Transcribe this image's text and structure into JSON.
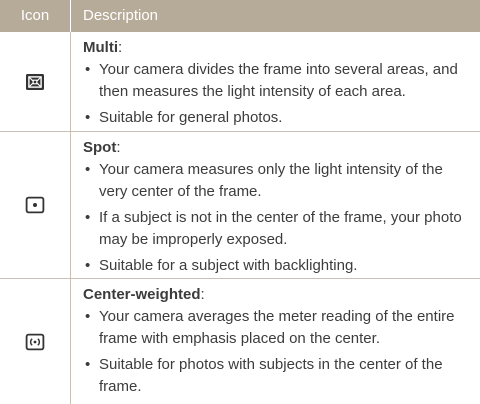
{
  "header": {
    "icon_col": "Icon",
    "desc_col": "Description"
  },
  "rows": [
    {
      "icon": "multi-metering-icon",
      "title": "Multi",
      "bullets": [
        "Your camera divides the frame into several areas, and then measures the light intensity of each area.",
        "Suitable for general photos."
      ]
    },
    {
      "icon": "spot-metering-icon",
      "title": "Spot",
      "bullets": [
        "Your camera measures only the light intensity of the very center of the frame.",
        "If a subject is not in the center of the frame, your photo may be improperly exposed.",
        "Suitable for a subject with backlighting."
      ]
    },
    {
      "icon": "center-weighted-metering-icon",
      "title": "Center-weighted",
      "bullets": [
        "Your camera averages the meter reading of the entire frame with emphasis placed on the center.",
        "Suitable for photos with subjects in the center of the frame."
      ]
    }
  ]
}
